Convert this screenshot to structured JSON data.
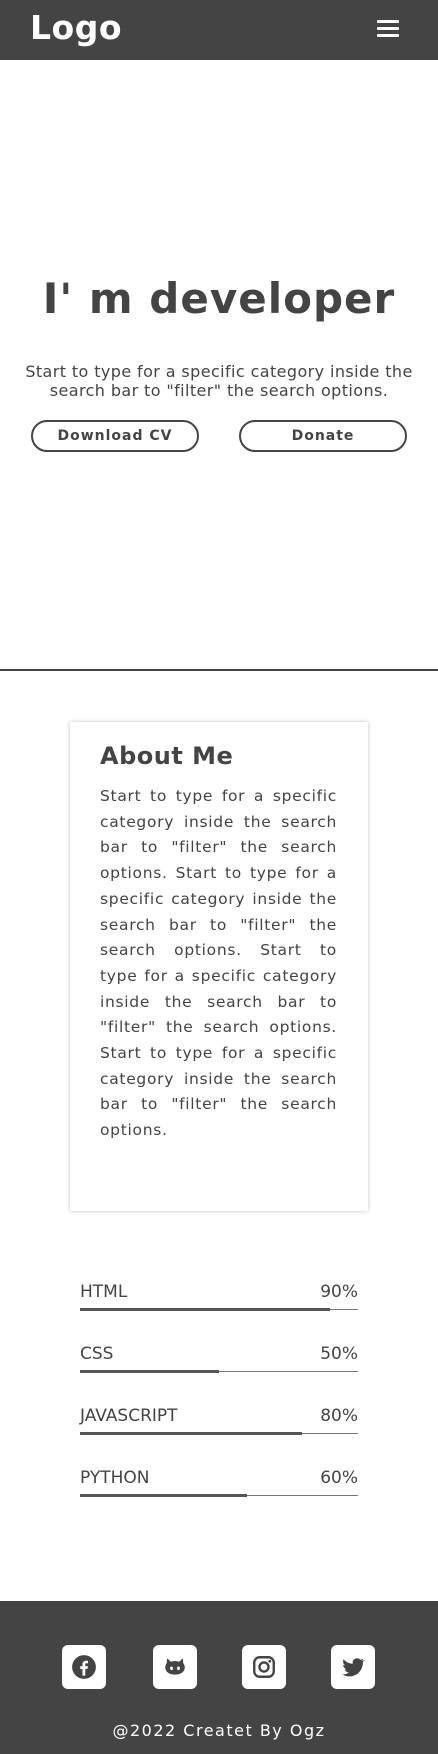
{
  "header": {
    "logo": "Logo",
    "menu_icon": "hamburger-menu-icon"
  },
  "hero": {
    "title": "I' m developer",
    "text": "Start to type for a specific category inside the search bar to \"filter\" the search options.",
    "download_label": "Download CV",
    "donate_label": "Donate"
  },
  "about": {
    "title": "About Me",
    "text": "Start to type for a specific category inside the search bar to \"filter\" the search options. Start to type for a specific category inside the search bar to \"filter\" the search options. Start to type for a specific category inside the search bar to \"filter\" the search options. Start to type for a specific category inside the search bar to \"filter\" the search options."
  },
  "skills": [
    {
      "name": "HTML",
      "percent_label": "90%",
      "level": 0.9
    },
    {
      "name": "CSS",
      "percent_label": "50%",
      "level": 0.5
    },
    {
      "name": "JAVASCRIPT",
      "percent_label": "80%",
      "level": 0.8
    },
    {
      "name": "PYTHON",
      "percent_label": "60%",
      "level": 0.6
    }
  ],
  "footer": {
    "social_icons": [
      "facebook-icon",
      "github-icon",
      "instagram-icon",
      "twitter-icon"
    ],
    "copyright": "@2022 Createt By Ogz"
  },
  "colors": {
    "primary": "#444444",
    "background": "#ffffff"
  }
}
